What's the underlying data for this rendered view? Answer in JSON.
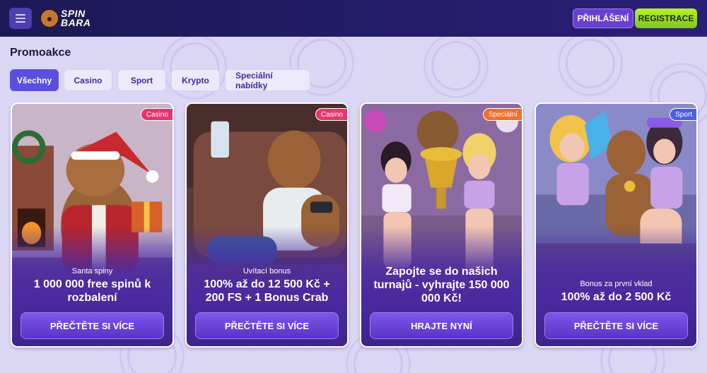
{
  "header": {
    "logo_line1": "SPIN",
    "logo_line2": "BARA",
    "login_label": "PŘIHLÁŠENÍ",
    "register_label": "REGISTRACE"
  },
  "page": {
    "title": "Promoakce"
  },
  "tabs": [
    {
      "label": "Všechny",
      "active": true
    },
    {
      "label": "Casino",
      "active": false
    },
    {
      "label": "Sport",
      "active": false
    },
    {
      "label": "Krypto",
      "active": false
    },
    {
      "label": "Speciální nabídky",
      "active": false
    }
  ],
  "cards": [
    {
      "badge": "Casino",
      "subtitle": "Santa spiny",
      "title": "1 000 000 free spinů k rozbalení",
      "button": "PŘEČTĚTE SI VÍCE"
    },
    {
      "badge": "Casino",
      "subtitle": "Uvítací bonus",
      "title": "100% až do 12 500 Kč + 200 FS + 1 Bonus Crab",
      "button": "PŘEČTĚTE SI VÍCE"
    },
    {
      "badge": "Speciální",
      "subtitle": "",
      "title": "Zapojte se do našich turnajů - vyhrajte 150 000 000 Kč!",
      "button": "HRAJTE NYNÍ"
    },
    {
      "badge": "Sport",
      "subtitle": "Bonus za první vklad",
      "title": "100% až do 2 500 Kč",
      "button": "PŘEČTĚTE SI VÍCE"
    }
  ],
  "colors": {
    "accent": "#5b4fe0",
    "register": "#9ee022",
    "badge_casino": "#e8346e",
    "badge_special": "#f36e2a",
    "badge_sport": "#4a5ee6"
  }
}
